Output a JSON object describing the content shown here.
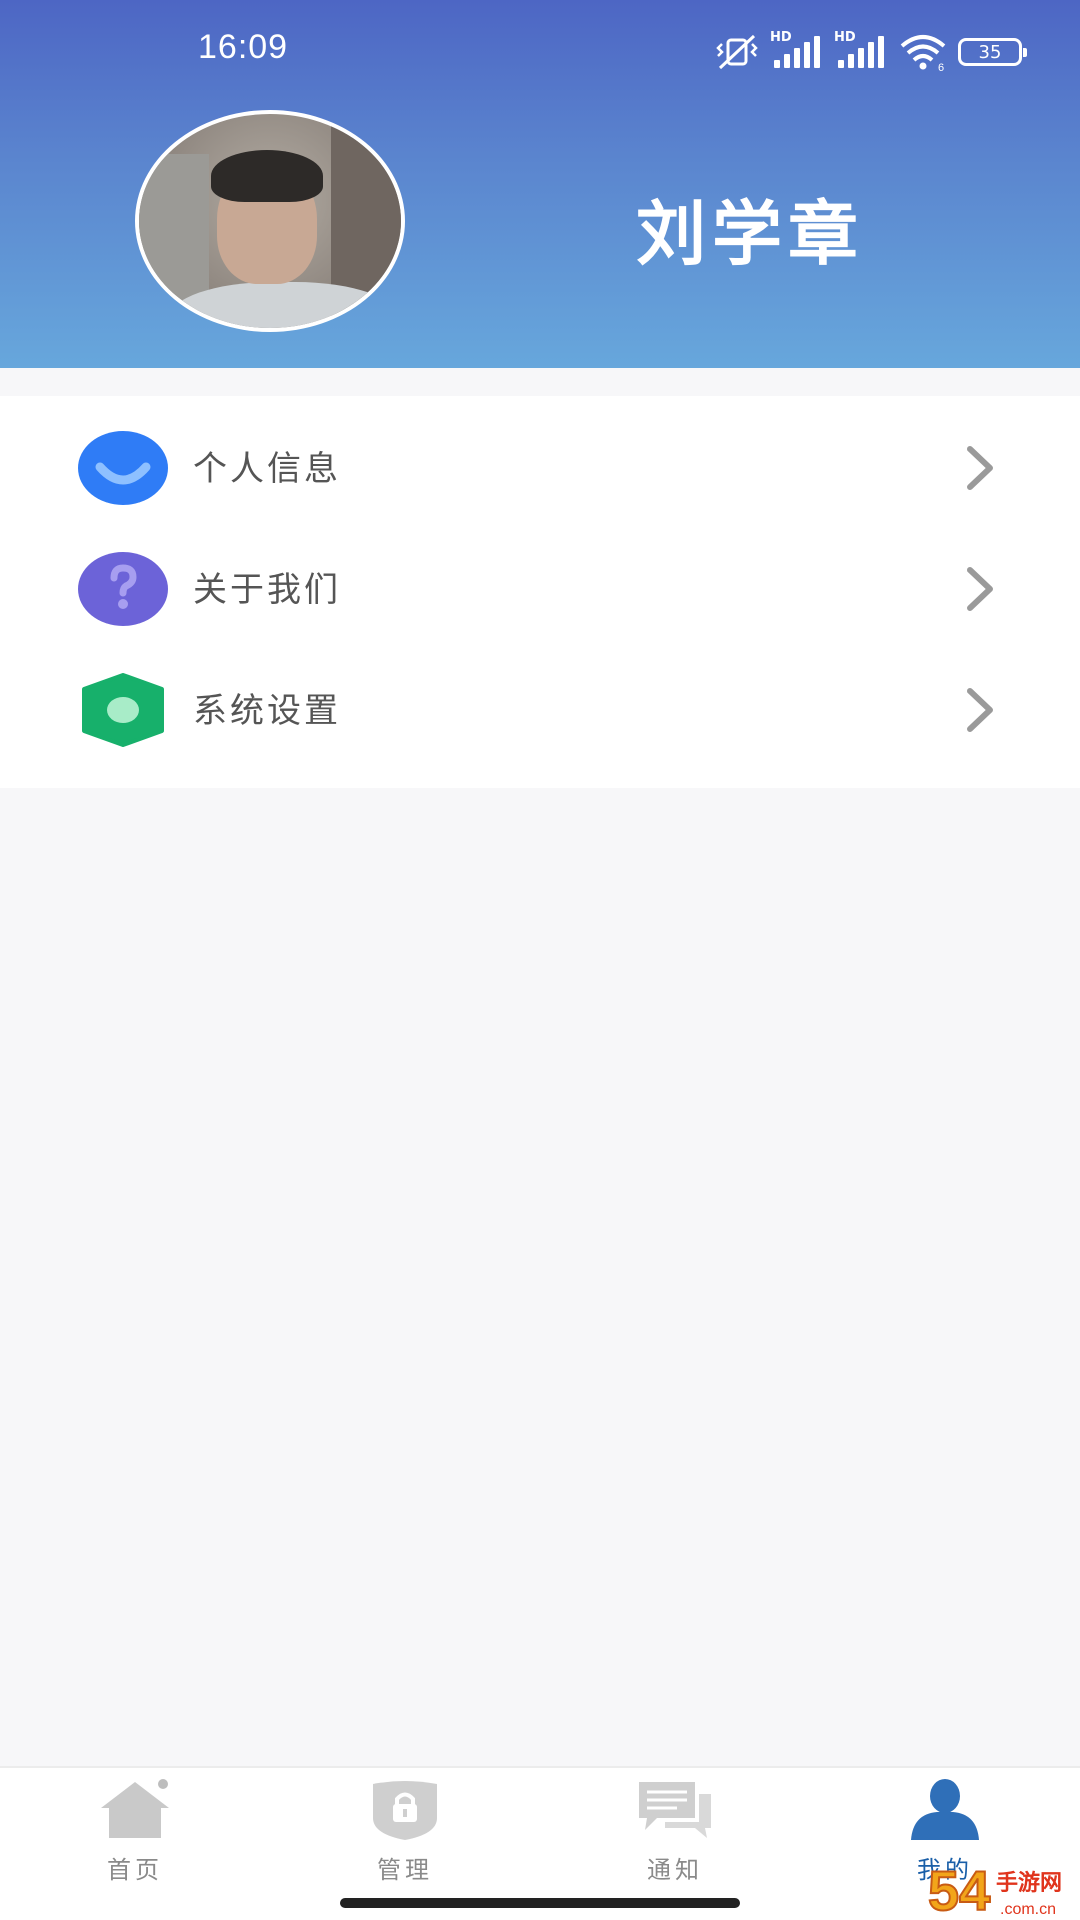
{
  "status_bar": {
    "time": "16:09",
    "signal_label": "HD",
    "battery": "35"
  },
  "profile": {
    "name": "刘学章",
    "avatar_icon": "avatar-photo"
  },
  "menu": {
    "items": [
      {
        "label": "个人信息",
        "icon": "smile-icon",
        "color": "#2f7cf6"
      },
      {
        "label": "关于我们",
        "icon": "question-icon",
        "color": "#6c63d8"
      },
      {
        "label": "系统设置",
        "icon": "settings-hexagon-icon",
        "color": "#17b06b"
      }
    ]
  },
  "tabbar": {
    "tabs": [
      {
        "label": "首页",
        "icon": "home-icon"
      },
      {
        "label": "管理",
        "icon": "lock-shield-icon"
      },
      {
        "label": "通知",
        "icon": "chat-bubbles-icon"
      },
      {
        "label": "我的",
        "icon": "user-icon",
        "active": true
      }
    ]
  },
  "watermark": {
    "brand": "54",
    "site": "手游网",
    "domain": ".com.cn"
  },
  "colors": {
    "header_top": "#4d66c4",
    "header_bottom": "#67a7dc",
    "active_tab": "#1a5fa8"
  }
}
